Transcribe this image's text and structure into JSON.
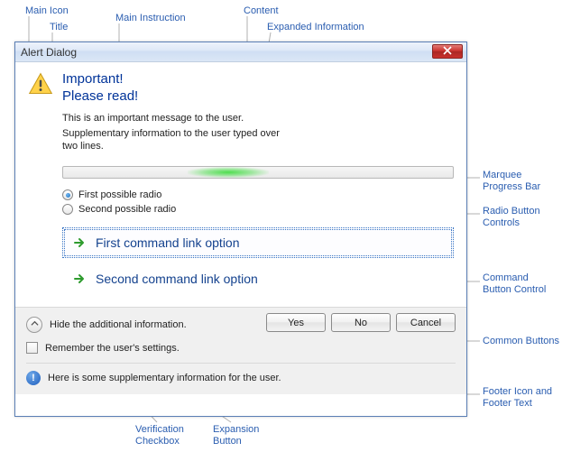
{
  "dialog": {
    "title": "Alert Dialog",
    "main_instruction_line1": "Important!",
    "main_instruction_line2": "Please read!",
    "content_text": "This is an important message to the user.",
    "supplementary_text": "Supplementary information to the user typed over two lines.",
    "radios": [
      {
        "label": "First possible radio",
        "checked": true
      },
      {
        "label": "Second possible radio",
        "checked": false
      }
    ],
    "command_links": [
      {
        "label": "First command link option",
        "selected": true
      },
      {
        "label": "Second command link option",
        "selected": false
      }
    ],
    "footer": {
      "expand_label": "Hide the additional information.",
      "verify_label": "Remember the user's settings.",
      "buttons": {
        "yes": "Yes",
        "no": "No",
        "cancel": "Cancel"
      },
      "info_text": "Here is some supplementary information for the user."
    }
  },
  "callouts": {
    "main_icon": "Main Icon",
    "title": "Title",
    "main_instruction": "Main Instruction",
    "content": "Content",
    "expanded_info": "Expanded Information",
    "marquee": "Marquee\nProgress Bar",
    "radio_controls": "Radio Button\nControls",
    "command_button": "Command\nButton Control",
    "common_buttons": "Common Buttons",
    "footer_icon_text": "Footer Icon and\nFooter Text",
    "verification_checkbox": "Verification\nCheckbox",
    "expansion_button": "Expansion\nButton"
  }
}
